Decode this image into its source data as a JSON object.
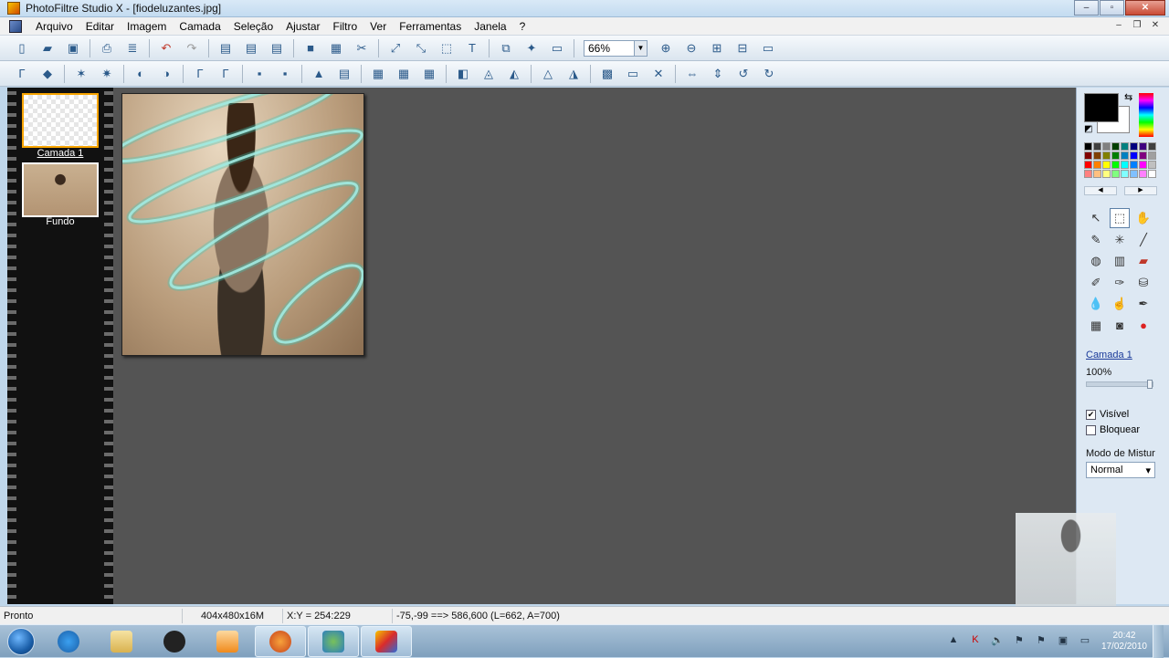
{
  "window": {
    "title": "PhotoFiltre Studio X - [fiodeluzantes.jpg]",
    "min": "–",
    "max": "▫",
    "close": "✕"
  },
  "menu": [
    "Arquivo",
    "Editar",
    "Imagem",
    "Camada",
    "Seleção",
    "Ajustar",
    "Filtro",
    "Ver",
    "Ferramentas",
    "Janela",
    "?"
  ],
  "mdi": {
    "min": "–",
    "restore": "❐",
    "close": "✕"
  },
  "zoom": {
    "value": "66%"
  },
  "layers": [
    {
      "label": "Camada 1"
    },
    {
      "label": "Fundo"
    }
  ],
  "panel": {
    "layer_name": "Camada 1",
    "opacity": "100%",
    "visible_label": "Visível",
    "visible_checked": true,
    "lock_label": "Bloquear",
    "lock_checked": false,
    "blend_title": "Modo de Mistur",
    "blend_value": "Normal",
    "fg_color": "#000000",
    "bg_color": "#ffffff"
  },
  "palette": [
    "#000000",
    "#404040",
    "#808080",
    "#004000",
    "#008080",
    "#000080",
    "#400080",
    "#404040",
    "#800000",
    "#804000",
    "#808000",
    "#008000",
    "#0080c0",
    "#0000ff",
    "#800080",
    "#a0a0a0",
    "#ff0000",
    "#ff8000",
    "#ffff00",
    "#00ff00",
    "#00ffff",
    "#0080ff",
    "#ff00ff",
    "#c0c0c0",
    "#ff8080",
    "#ffc080",
    "#ffff80",
    "#80ff80",
    "#80ffff",
    "#80c0ff",
    "#ff80ff",
    "#ffffff"
  ],
  "status": {
    "state": "Pronto",
    "size": "404x480x16M",
    "coords": "X:Y = 254:229",
    "selection": "-75,-99 ==> 586,600 (L=662, A=700)"
  },
  "clock": {
    "time": "20:42",
    "date": "17/02/2010"
  }
}
